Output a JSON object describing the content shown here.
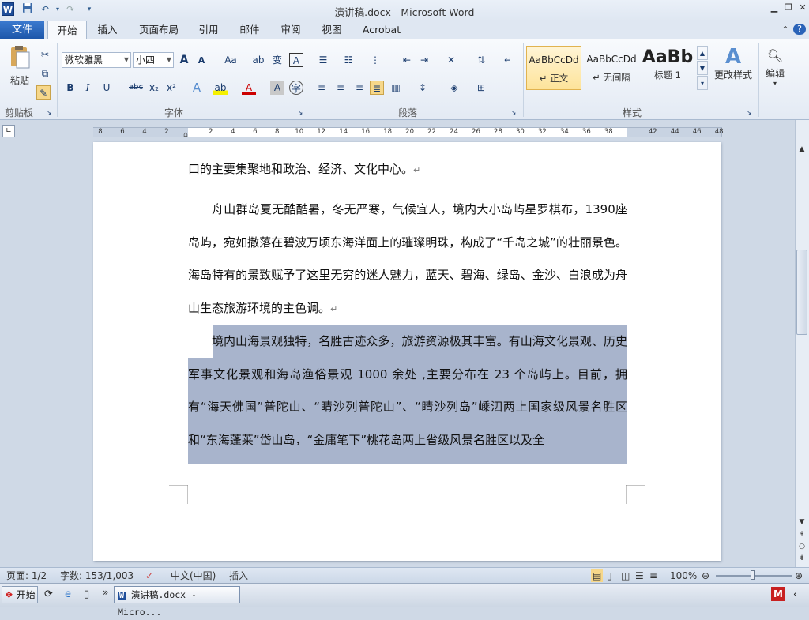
{
  "window": {
    "title": "演讲稿.docx - Microsoft Word",
    "logo": "W",
    "undo_icon": "undo-icon",
    "redo_icon": "redo-icon"
  },
  "tabs": [
    "文件",
    "开始",
    "插入",
    "页面布局",
    "引用",
    "邮件",
    "审阅",
    "视图",
    "Acrobat"
  ],
  "ribbon": {
    "clipboard": {
      "paste_label": "粘贴",
      "group_label": "剪贴板"
    },
    "font": {
      "font_name": "微软雅黑",
      "font_size": "小四",
      "group_label": "字体",
      "bold": "B",
      "italic": "I",
      "underline": "U",
      "strike": "abc",
      "sub": "x₂",
      "sup": "x²",
      "grow": "A",
      "shrink": "A",
      "case": "Aa"
    },
    "paragraph": {
      "group_label": "段落"
    },
    "styles": {
      "group_label": "样式",
      "items": [
        {
          "sample": "AaBbCcDd",
          "name": "↵ 正文"
        },
        {
          "sample": "AaBbCcDd",
          "name": "↵ 无间隔"
        },
        {
          "sample": "AaBb",
          "name": "标题 1"
        }
      ],
      "change_styles": "更改样式"
    },
    "editing": {
      "label": "编辑"
    }
  },
  "ruler": {
    "ticks": [
      "8",
      "6",
      "4",
      "2",
      "",
      "2",
      "4",
      "6",
      "8",
      "10",
      "12",
      "14",
      "16",
      "18",
      "20",
      "22",
      "24",
      "26",
      "28",
      "30",
      "32",
      "34",
      "36",
      "38",
      "",
      "42",
      "44",
      "46",
      "48"
    ]
  },
  "document": {
    "paragraphs": [
      {
        "text": "口的主要集聚地和政治、经济、文化中心。",
        "mark": "↵"
      },
      {
        "text": "舟山群岛夏无酷酷暑，冬无严寒，气候宜人，境内大小岛屿星罗棋布，1390座岛屿，宛如撒落在碧波万顷东海洋面上的璀璨明珠，构成了“千岛之城”的壮丽景色。海岛特有的景致赋予了这里无穷的迷人魅力，蓝天、碧海、绿岛、金沙、白浪成为舟山生态旅游环境的主色调。",
        "mark": "↵"
      },
      {
        "text": "境内山海景观独特，名胜古迹众多，旅游资源极其丰富。有山海文化景观、历史军事文化景观和海岛渔俗景观 1000 余处 ,主要分布在 23 个岛屿上。目前，拥有“海天佛国”普陀山、“睛沙列普陀山”、“睛沙列岛”嵊泗两上国家级风景名胜区和“东海蓬莱”岱山岛，“金庸笔下”桃花岛两上省级风景名胜区以及全",
        "mark": ""
      }
    ]
  },
  "status": {
    "page": "页面: 1/2",
    "words": "字数: 153/1,003",
    "language": "中文(中国)",
    "mode": "插入",
    "zoom": "100%"
  },
  "taskbar": {
    "start": "开始",
    "item": "演讲稿.docx - Micro...",
    "chevron": "»"
  },
  "colors": {
    "selection": "#a8b4cc",
    "file_tab": "#2a63b8",
    "ribbon_bg": "#e3eaf4"
  }
}
